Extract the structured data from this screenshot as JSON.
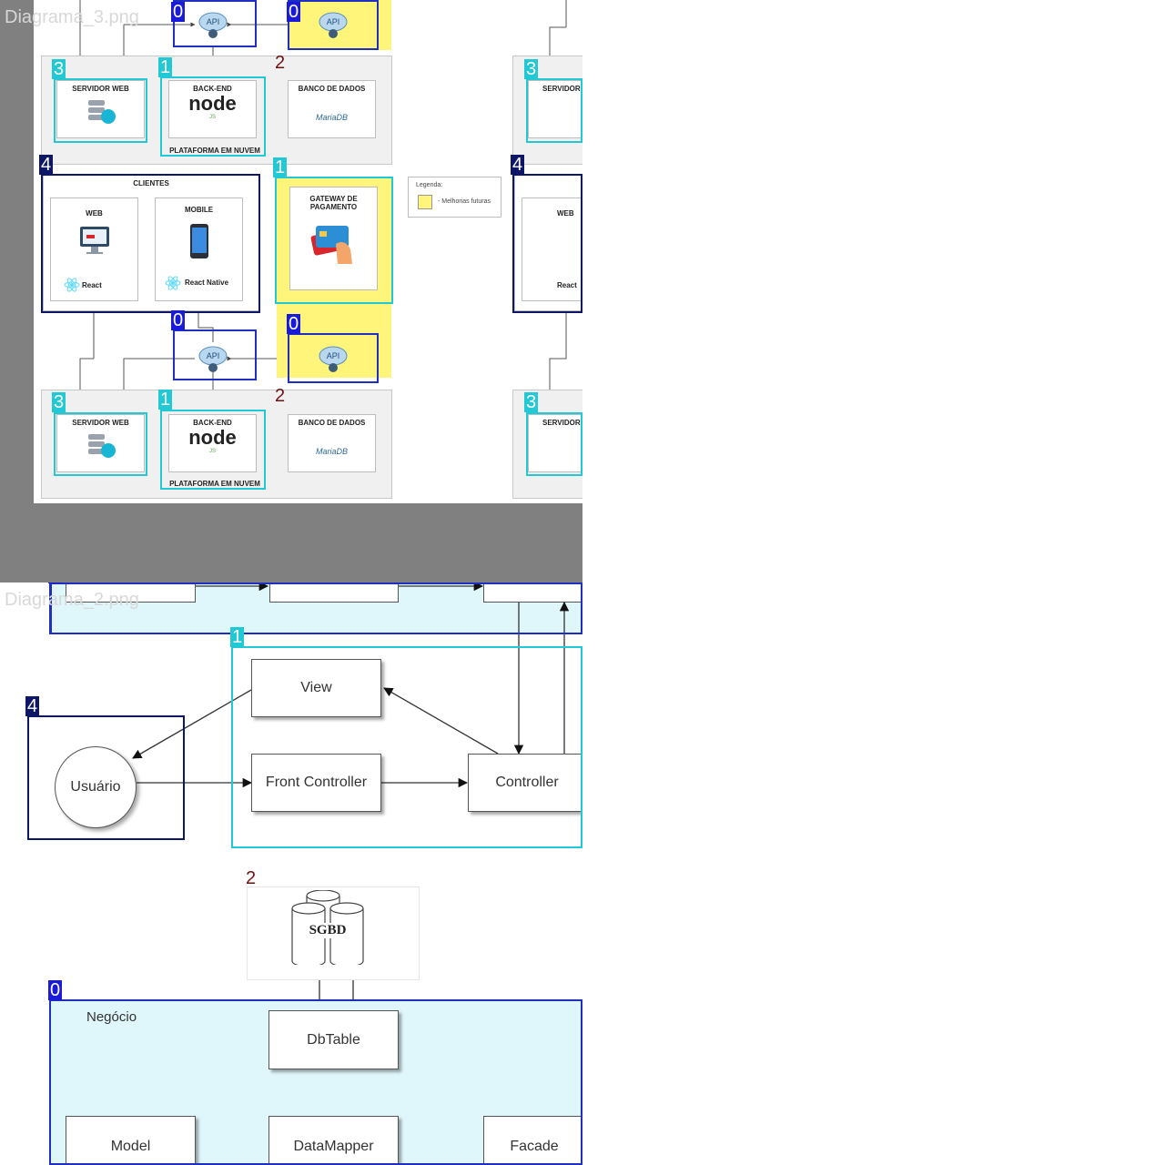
{
  "diagram3": {
    "file_label": "Diagrama_3.png",
    "server_web": "SERVIDOR WEB",
    "server_web_cut": "SERVIDOR",
    "backend": "BACK-END",
    "node": "node",
    "node_sub": "JS",
    "database": "BANCO DE DADOS",
    "mariadb": "MariaDB",
    "cloud_platform": "PLATAFORMA EM NUVEM",
    "clients": "CLIENTES",
    "web": "WEB",
    "mobile": "MOBILE",
    "react": "React",
    "react_native": "React Native",
    "gateway": "GATEWAY DE PAGAMENTO",
    "legend_title": "Legenda:",
    "legend_item": "- Melhorias futuras",
    "api": "API"
  },
  "diagram2": {
    "file_label": "Diagrama_2.png",
    "view": "View",
    "user": "Usuário",
    "front_controller": "Front Controller",
    "controller": "Controller",
    "sgbd": "SGBD",
    "business": "Negócio",
    "dbtable": "DbTable",
    "model": "Model",
    "datamapper": "DataMapper",
    "facade": "Facade"
  },
  "annotations": {
    "n0": "0",
    "n1": "1",
    "n2": "2",
    "n3": "3",
    "n4": "4"
  },
  "colors": {
    "annotation_blue": "#1a1adb",
    "annotation_cyan": "#22c9d4",
    "annotation_navy": "#0e1766",
    "future_yellow": "#fff57a",
    "layer_lightblue": "#dff6fb"
  }
}
